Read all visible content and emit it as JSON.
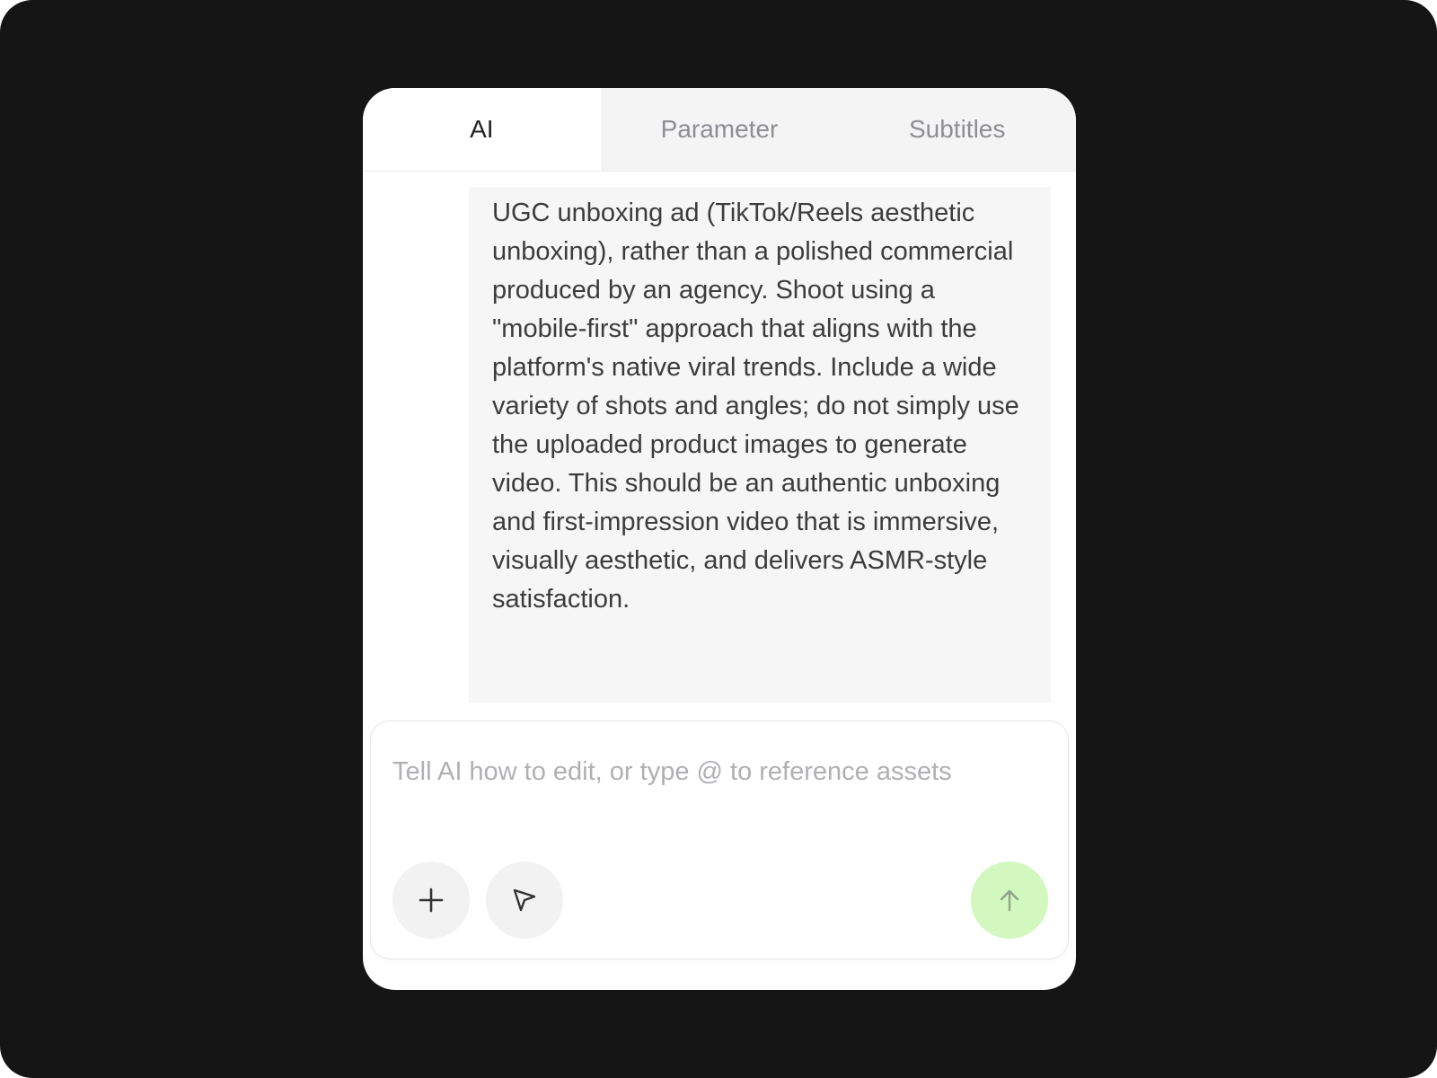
{
  "tabs": [
    {
      "label": "AI",
      "active": true
    },
    {
      "label": "Parameter",
      "active": false
    },
    {
      "label": "Subtitles",
      "active": false
    }
  ],
  "message": {
    "text": "UGC unboxing ad (TikTok/Reels aesthetic unboxing), rather than a polished commercial produced by an agency. Shoot using a \"mobile-first\" approach that aligns with the platform's native viral trends. Include a wide variety of shots and angles; do not simply use the uploaded product images to generate video. This should be an authentic unboxing and first-impression video that is immersive, visually aesthetic, and delivers ASMR-style satisfaction."
  },
  "composer": {
    "placeholder": "Tell AI how to edit, or type @ to reference assets",
    "value": ""
  },
  "icons": {
    "download": "download-icon",
    "add": "plus-icon",
    "select": "cursor-arrow-icon",
    "send": "arrow-up-icon"
  },
  "colors": {
    "background": "#151515",
    "panel": "#ffffff",
    "message_bubble": "#f6f6f6",
    "send_button": "#d2f7bf"
  }
}
